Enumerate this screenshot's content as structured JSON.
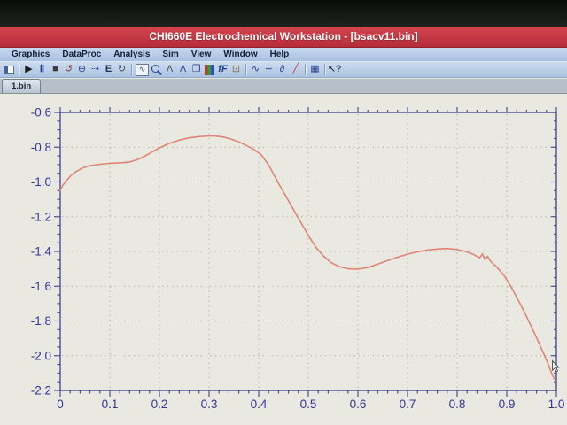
{
  "window": {
    "title": "CHI660E Electrochemical Workstation - [bsacv11.bin]"
  },
  "menu": {
    "items": [
      "Graphics",
      "DataProc",
      "Analysis",
      "Sim",
      "View",
      "Window",
      "Help"
    ]
  },
  "toolbar": {
    "icons": [
      {
        "name": "file-window-icon",
        "shape": "window"
      },
      {
        "name": "separator"
      },
      {
        "name": "run-icon",
        "glyph": "▶",
        "color": "#1b1b1b"
      },
      {
        "name": "pause-icon",
        "glyph": "Ⅱ",
        "color": "#24418f",
        "bold": true
      },
      {
        "name": "stop-icon",
        "glyph": "■",
        "color": "#3d3d3d"
      },
      {
        "name": "reverse-scan-icon",
        "glyph": "↺",
        "color": "#76383a"
      },
      {
        "name": "zero-current-icon",
        "glyph": "⊖",
        "color": "#2c3f90"
      },
      {
        "name": "ramp-icon",
        "glyph": "⇢",
        "color": "#2c3f90"
      },
      {
        "name": "open-circuit-e-icon",
        "glyph": "E",
        "color": "#20304f",
        "bold": true
      },
      {
        "name": "rotation-icon",
        "glyph": "↻",
        "color": "#474747"
      },
      {
        "name": "separator"
      },
      {
        "name": "graph-window-icon",
        "glyph": "∿",
        "color": "#2c3f90",
        "framed": true
      },
      {
        "name": "zoom-icon",
        "shape": "zoom"
      },
      {
        "name": "peak-definition-icon",
        "glyph": "Λ",
        "color": "#4a4a4a"
      },
      {
        "name": "peak-report-icon",
        "glyph": "Λ",
        "color": "#2c3f90"
      },
      {
        "name": "overlay-plots-icon",
        "glyph": "❐",
        "color": "#2c3f90"
      },
      {
        "name": "rgb-bars-icon",
        "shape": "rgb"
      },
      {
        "name": "ff-scale-icon",
        "glyph": "fF",
        "color": "#24418f",
        "italic": true,
        "bold": true
      },
      {
        "name": "copy-clipboard-icon",
        "glyph": "⊡",
        "color": "#8a6a3f"
      },
      {
        "name": "separator"
      },
      {
        "name": "smooth-icon",
        "glyph": "∿",
        "color": "#2c3f90"
      },
      {
        "name": "semi-derivative-icon",
        "glyph": "∼",
        "color": "#2c3f90"
      },
      {
        "name": "derivative-icon",
        "glyph": "∂",
        "color": "#2c3f90"
      },
      {
        "name": "slope-baseline-icon",
        "glyph": "╱",
        "color": "#bb3a3a"
      },
      {
        "name": "separator"
      },
      {
        "name": "data-grid-icon",
        "glyph": "▦",
        "color": "#2c3f90"
      },
      {
        "name": "separator"
      },
      {
        "name": "context-help-icon",
        "glyph": "↖?",
        "color": "#101010"
      }
    ]
  },
  "tabs": {
    "active": "1.bin"
  },
  "chart_data": {
    "type": "line",
    "title": "",
    "xlabel": "",
    "ylabel": "",
    "xlim": [
      0,
      1.0
    ],
    "ylim": [
      -2.2,
      -0.6
    ],
    "x_ticks": [
      [
        0,
        "0"
      ],
      [
        0.1,
        "0.1"
      ],
      [
        0.2,
        "0.2"
      ],
      [
        0.3,
        "0.3"
      ],
      [
        0.4,
        "0.4"
      ],
      [
        0.5,
        "0.5"
      ],
      [
        0.6,
        "0.6"
      ],
      [
        0.7,
        "0.7"
      ],
      [
        0.8,
        "0.8"
      ],
      [
        0.9,
        "0.9"
      ],
      [
        1.0,
        "1.0"
      ]
    ],
    "y_ticks": [
      [
        -0.6,
        "-0.6"
      ],
      [
        -0.8,
        "-0.8"
      ],
      [
        -1.0,
        "-1.0"
      ],
      [
        -1.2,
        "-1.2"
      ],
      [
        -1.4,
        "-1.4"
      ],
      [
        -1.6,
        "-1.6"
      ],
      [
        -1.8,
        "-1.8"
      ],
      [
        -2.0,
        "-2.0"
      ],
      [
        -2.2,
        "-2.2"
      ]
    ],
    "x_minor_step": 0.02,
    "y_minor_step": 0.05,
    "grid": {
      "style": "dotted",
      "color": "#aaaa9a",
      "x_lines": [
        0.1,
        0.2,
        0.3,
        0.4,
        0.5,
        0.6,
        0.7,
        0.8,
        0.9
      ],
      "y_lines": [
        -0.8,
        -1.0,
        -1.2,
        -1.4,
        -1.6,
        -1.8,
        -2.0
      ]
    },
    "axis_color": "#41418f",
    "tick_label_color": "#34349a",
    "series": [
      {
        "name": "cv-trace",
        "color": "#e08474",
        "width": 1.6,
        "points": [
          [
            0.0,
            -1.05
          ],
          [
            0.005,
            -1.02
          ],
          [
            0.012,
            -0.995
          ],
          [
            0.022,
            -0.962
          ],
          [
            0.032,
            -0.94
          ],
          [
            0.045,
            -0.92
          ],
          [
            0.06,
            -0.906
          ],
          [
            0.08,
            -0.898
          ],
          [
            0.1,
            -0.893
          ],
          [
            0.12,
            -0.89
          ],
          [
            0.14,
            -0.885
          ],
          [
            0.155,
            -0.872
          ],
          [
            0.17,
            -0.852
          ],
          [
            0.185,
            -0.828
          ],
          [
            0.2,
            -0.804
          ],
          [
            0.22,
            -0.778
          ],
          [
            0.24,
            -0.759
          ],
          [
            0.26,
            -0.746
          ],
          [
            0.28,
            -0.739
          ],
          [
            0.3,
            -0.735
          ],
          [
            0.315,
            -0.736
          ],
          [
            0.33,
            -0.742
          ],
          [
            0.345,
            -0.754
          ],
          [
            0.36,
            -0.769
          ],
          [
            0.375,
            -0.79
          ],
          [
            0.39,
            -0.812
          ],
          [
            0.405,
            -0.843
          ],
          [
            0.42,
            -0.902
          ],
          [
            0.44,
            -1.008
          ],
          [
            0.46,
            -1.108
          ],
          [
            0.48,
            -1.208
          ],
          [
            0.5,
            -1.308
          ],
          [
            0.515,
            -1.375
          ],
          [
            0.53,
            -1.425
          ],
          [
            0.545,
            -1.462
          ],
          [
            0.56,
            -1.485
          ],
          [
            0.58,
            -1.5
          ],
          [
            0.6,
            -1.502
          ],
          [
            0.62,
            -1.492
          ],
          [
            0.64,
            -1.473
          ],
          [
            0.66,
            -1.452
          ],
          [
            0.68,
            -1.433
          ],
          [
            0.7,
            -1.416
          ],
          [
            0.72,
            -1.402
          ],
          [
            0.74,
            -1.392
          ],
          [
            0.76,
            -1.386
          ],
          [
            0.778,
            -1.383
          ],
          [
            0.795,
            -1.387
          ],
          [
            0.815,
            -1.398
          ],
          [
            0.832,
            -1.416
          ],
          [
            0.845,
            -1.437
          ],
          [
            0.851,
            -1.414
          ],
          [
            0.856,
            -1.448
          ],
          [
            0.861,
            -1.428
          ],
          [
            0.868,
            -1.458
          ],
          [
            0.88,
            -1.49
          ],
          [
            0.895,
            -1.54
          ],
          [
            0.91,
            -1.61
          ],
          [
            0.925,
            -1.69
          ],
          [
            0.94,
            -1.775
          ],
          [
            0.955,
            -1.865
          ],
          [
            0.967,
            -1.94
          ],
          [
            0.977,
            -2.005
          ],
          [
            0.985,
            -2.06
          ],
          [
            0.991,
            -2.105
          ],
          [
            0.996,
            -2.135
          ]
        ]
      }
    ],
    "cursor": {
      "x": 0.992,
      "y": -2.03
    }
  },
  "colors": {
    "bezel": "#121411",
    "titlebar": "#c43843",
    "titlebar_text": "#ffffff",
    "menubar": "#b7cce8",
    "plot_bg": "#e9e9e1"
  }
}
